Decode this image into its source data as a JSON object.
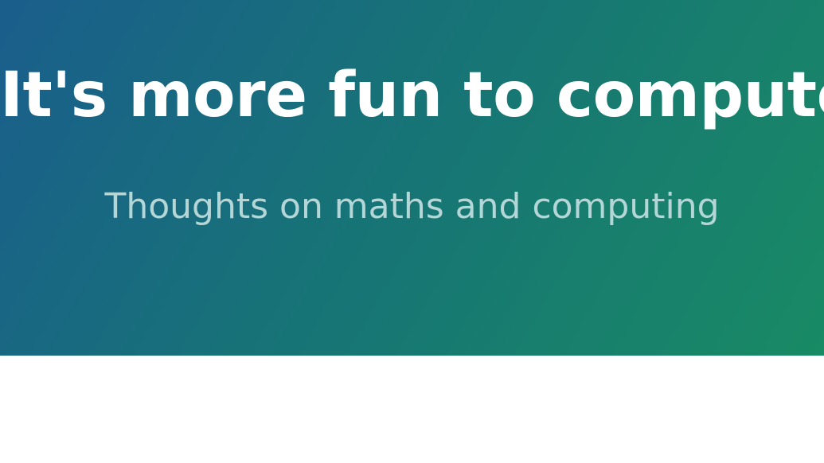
{
  "header": {
    "title": "It's more fun to compute",
    "subtitle": "Thoughts on maths and computing"
  },
  "colors": {
    "gradient_start": "#1a5e8c",
    "gradient_end": "#188a64",
    "title": "#ffffff",
    "subtitle": "#b5d6d6",
    "accent": "#1b8a6e"
  }
}
